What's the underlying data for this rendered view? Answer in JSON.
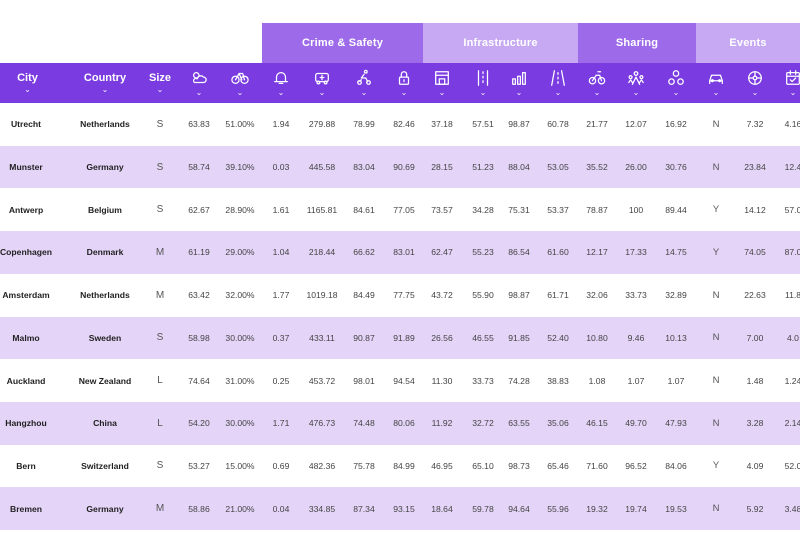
{
  "groups": [
    {
      "label": "Crime & Safety",
      "color": "#9d6be9"
    },
    {
      "label": "Infrastructure",
      "color": "#c6a9f2"
    },
    {
      "label": "Sharing",
      "color": "#9d6be9"
    },
    {
      "label": "Events",
      "color": "#c6a9f2"
    }
  ],
  "columns": [
    "City",
    "Country",
    "Size"
  ],
  "icons": [
    "weather-icon",
    "bicycle-icon",
    "bell-icon",
    "ambulance-icon",
    "cyclist-icon",
    "lock-icon",
    "bike-shop-icon",
    "bike-lane-icon",
    "bar-chart-icon",
    "road-icon",
    "bike-share-icon",
    "group-icon",
    "network-icon",
    "car-icon",
    "wheel-icon",
    "calendar-icon"
  ],
  "rows": [
    {
      "city": "Utrecht",
      "country": "Netherlands",
      "size": "S",
      "values": [
        "63.83",
        "51.00%",
        "1.94",
        "279.88",
        "78.99",
        "82.46",
        "37.18",
        "57.51",
        "98.87",
        "60.78",
        "21.77",
        "12.07",
        "16.92",
        "N",
        "7.32",
        "4.16"
      ]
    },
    {
      "city": "Munster",
      "country": "Germany",
      "size": "S",
      "values": [
        "58.74",
        "39.10%",
        "0.03",
        "445.58",
        "83.04",
        "90.69",
        "28.15",
        "51.23",
        "88.04",
        "53.05",
        "35.52",
        "26.00",
        "30.76",
        "N",
        "23.84",
        "12.4"
      ]
    },
    {
      "city": "Antwerp",
      "country": "Belgium",
      "size": "S",
      "values": [
        "62.67",
        "28.90%",
        "1.61",
        "1165.81",
        "84.61",
        "77.05",
        "73.57",
        "34.28",
        "75.31",
        "53.37",
        "78.87",
        "100",
        "89.44",
        "Y",
        "14.12",
        "57.0"
      ]
    },
    {
      "city": "Copenhagen",
      "country": "Denmark",
      "size": "M",
      "values": [
        "61.19",
        "29.00%",
        "1.04",
        "218.44",
        "66.62",
        "83.01",
        "62.47",
        "55.23",
        "86.54",
        "61.60",
        "12.17",
        "17.33",
        "14.75",
        "Y",
        "74.05",
        "87.0"
      ]
    },
    {
      "city": "Amsterdam",
      "country": "Netherlands",
      "size": "M",
      "values": [
        "63.42",
        "32.00%",
        "1.77",
        "1019.18",
        "84.49",
        "77.75",
        "43.72",
        "55.90",
        "98.87",
        "61.71",
        "32.06",
        "33.73",
        "32.89",
        "N",
        "22.63",
        "11.8"
      ]
    },
    {
      "city": "Malmo",
      "country": "Sweden",
      "size": "S",
      "values": [
        "58.98",
        "30.00%",
        "0.37",
        "433.11",
        "90.87",
        "91.89",
        "26.56",
        "46.55",
        "91.85",
        "52.40",
        "10.80",
        "9.46",
        "10.13",
        "N",
        "7.00",
        "4.0"
      ]
    },
    {
      "city": "Auckland",
      "country": "New Zealand",
      "size": "L",
      "values": [
        "74.64",
        "31.00%",
        "0.25",
        "453.72",
        "98.01",
        "94.54",
        "11.30",
        "33.73",
        "74.28",
        "38.83",
        "1.08",
        "1.07",
        "1.07",
        "N",
        "1.48",
        "1.24"
      ]
    },
    {
      "city": "Hangzhou",
      "country": "China",
      "size": "L",
      "values": [
        "54.20",
        "30.00%",
        "1.71",
        "476.73",
        "74.48",
        "80.06",
        "11.92",
        "32.72",
        "63.55",
        "35.06",
        "46.15",
        "49.70",
        "47.93",
        "N",
        "3.28",
        "2.14"
      ]
    },
    {
      "city": "Bern",
      "country": "Switzerland",
      "size": "S",
      "values": [
        "53.27",
        "15.00%",
        "0.69",
        "482.36",
        "75.78",
        "84.99",
        "46.95",
        "65.10",
        "98.73",
        "65.46",
        "71.60",
        "96.52",
        "84.06",
        "Y",
        "4.09",
        "52.0"
      ]
    },
    {
      "city": "Bremen",
      "country": "Germany",
      "size": "M",
      "values": [
        "58.86",
        "21.00%",
        "0.04",
        "334.85",
        "87.34",
        "93.15",
        "18.64",
        "59.78",
        "94.64",
        "55.96",
        "19.32",
        "19.74",
        "19.53",
        "N",
        "5.92",
        "3.48"
      ]
    }
  ]
}
